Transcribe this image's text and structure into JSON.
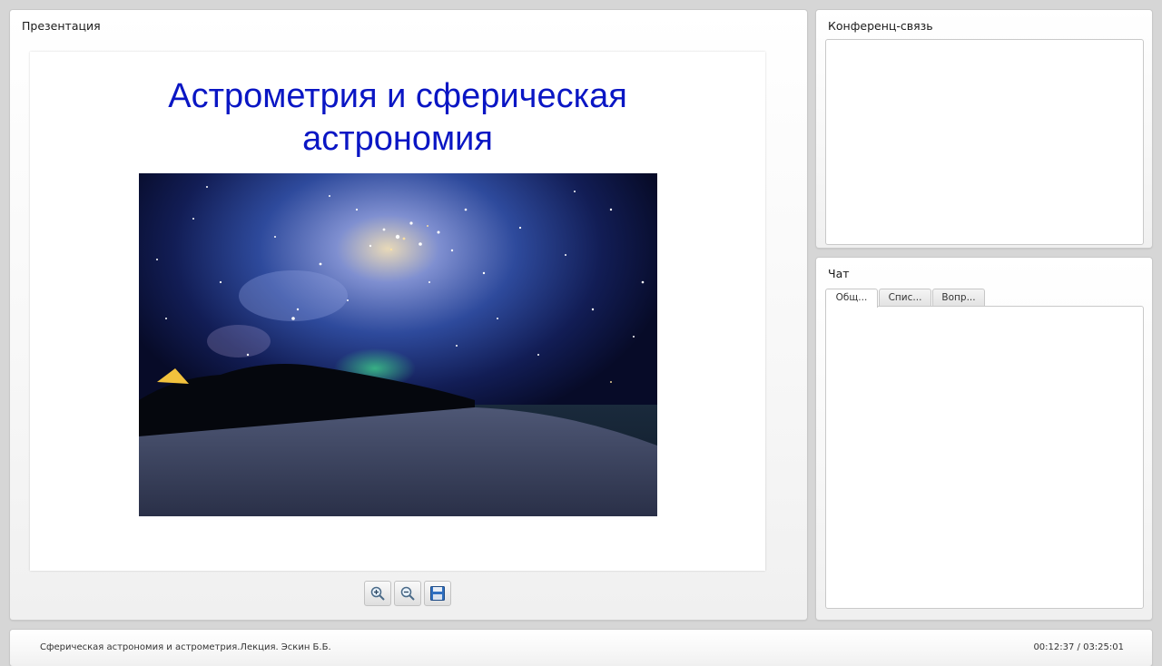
{
  "presentation": {
    "title": "Презентация",
    "slide_title": "Астрометрия и сферическая\nастрономия",
    "toolbar": {
      "zoom_in_icon": "zoom-in-icon",
      "zoom_out_icon": "zoom-out-icon",
      "save_icon": "floppy-disk-icon"
    }
  },
  "conference": {
    "title": "Конференц-связь"
  },
  "chat": {
    "title": "Чат",
    "tabs": [
      {
        "label": "Общ..."
      },
      {
        "label": "Спис..."
      },
      {
        "label": "Вопр..."
      }
    ],
    "active_tab": "Общ..."
  },
  "footer": {
    "title": "Сферическая астрономия и астрометрия.Лекция. Эскин Б.Б.",
    "time": "00:12:37 / 03:25:01"
  },
  "colors": {
    "slide_title": "#0a16c4",
    "page_bg": "#d6d6d6"
  }
}
